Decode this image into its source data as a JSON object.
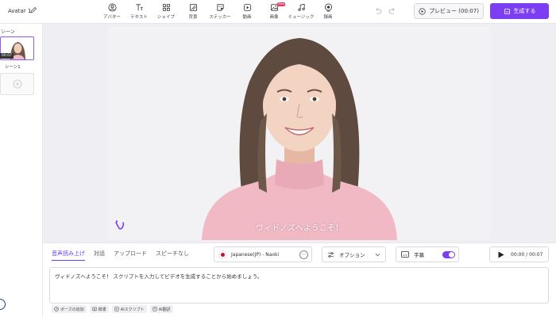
{
  "header": {
    "project_title": "Avatar 1",
    "tools": [
      {
        "label": "アバター",
        "icon": "avatar-icon"
      },
      {
        "label": "テキスト",
        "icon": "text-icon"
      },
      {
        "label": "シェイプ",
        "icon": "shape-icon"
      },
      {
        "label": "背景",
        "icon": "background-icon"
      },
      {
        "label": "ステッカー",
        "icon": "sticker-icon"
      },
      {
        "label": "動画",
        "icon": "video-icon"
      },
      {
        "label": "画像",
        "icon": "image-icon",
        "badge": "New"
      },
      {
        "label": "ミュージック",
        "icon": "music-icon"
      },
      {
        "label": "録画",
        "icon": "record-icon"
      }
    ],
    "preview_label": "プレビュー (00:07)",
    "generate_label": "生成する"
  },
  "scenes": {
    "title": "シーン",
    "items": [
      {
        "label": "シーン1",
        "duration": "00:07"
      }
    ]
  },
  "canvas": {
    "caption": "ヴィドノズへようこそ！"
  },
  "script_panel": {
    "tabs": [
      "音声読み上げ",
      "対話",
      "アップロード",
      "スピーチなし"
    ],
    "active_tab": 0,
    "voice": "Japanese(JP) - Naoki",
    "options_label": "オプション",
    "subtitle_label": "字幕",
    "subtitle_enabled": true,
    "time_readout": "00:00 / 00:07",
    "script_text": "ヴィドノズへようこそ！ スクリプトを入力してビデオを生成することから始めましょう。",
    "tools": [
      "ポーズの追加",
      "辞書",
      "AIスクリプト",
      "AI翻訳"
    ]
  },
  "colors": {
    "accent": "#7b3ef2",
    "flag_red": "#c8102e",
    "sweater": "#f0b9c4"
  }
}
